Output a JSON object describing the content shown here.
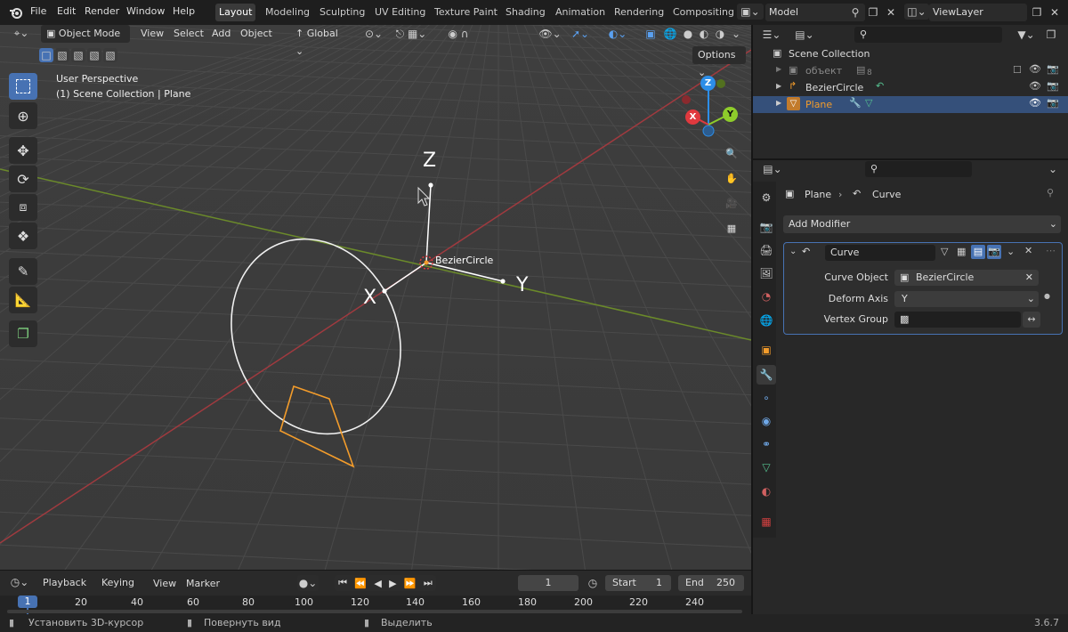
{
  "menu": {
    "items": [
      "File",
      "Edit",
      "Render",
      "Window",
      "Help"
    ]
  },
  "workspaces": {
    "tabs": [
      "Layout",
      "Modeling",
      "Sculpting",
      "UV Editing",
      "Texture Paint",
      "Shading",
      "Animation",
      "Rendering",
      "Compositing"
    ],
    "active": "Layout"
  },
  "scene": {
    "name": "Model"
  },
  "view_layer": {
    "name": "ViewLayer"
  },
  "viewport_header": {
    "mode": "Object Mode",
    "menus": [
      "View",
      "Select",
      "Add",
      "Object"
    ],
    "transform_orientation": "Global",
    "options_label": "Options"
  },
  "viewport": {
    "perspective": "User Perspective",
    "collection_info": "(1) Scene Collection | Plane",
    "object_label": "BezierCircle",
    "gizmo_axes": {
      "z": "Z",
      "y": "Y",
      "x": "X"
    },
    "nav_gizmo": {
      "x": "X",
      "y": "Y",
      "z": "Z"
    }
  },
  "colors": {
    "accent": "#4772b3",
    "x_axis": "#e0393e",
    "y_axis": "#8ecc2b",
    "z_axis": "#2c8ee8",
    "selected_orange": "#f39c2b"
  },
  "timeline": {
    "menus": [
      "Playback",
      "Keying",
      "View",
      "Marker"
    ],
    "current_frame": "1",
    "start_label": "Start",
    "start_value": "1",
    "end_label": "End",
    "end_value": "250",
    "ruler": [
      "1",
      "20",
      "40",
      "60",
      "80",
      "100",
      "120",
      "140",
      "160",
      "180",
      "200",
      "220",
      "240"
    ]
  },
  "statusbar": {
    "items": [
      "Установить 3D-курсор",
      "Повернуть вид",
      "Выделить"
    ],
    "version": "3.6.7"
  },
  "outliner": {
    "root": "Scene Collection",
    "items": [
      {
        "label": "объект",
        "badge": "8",
        "dim": true
      },
      {
        "label": "BezierCircle",
        "dim": false
      },
      {
        "label": "Plane",
        "selected": true
      }
    ]
  },
  "properties": {
    "breadcrumb_object": "Plane",
    "breadcrumb_modifier": "Curve",
    "add_modifier": "Add Modifier",
    "modifier": {
      "name": "Curve",
      "fields": [
        {
          "label": "Curve Object",
          "value": "BezierCircle"
        },
        {
          "label": "Deform Axis",
          "value": "Y"
        },
        {
          "label": "Vertex Group",
          "value": ""
        }
      ]
    }
  }
}
